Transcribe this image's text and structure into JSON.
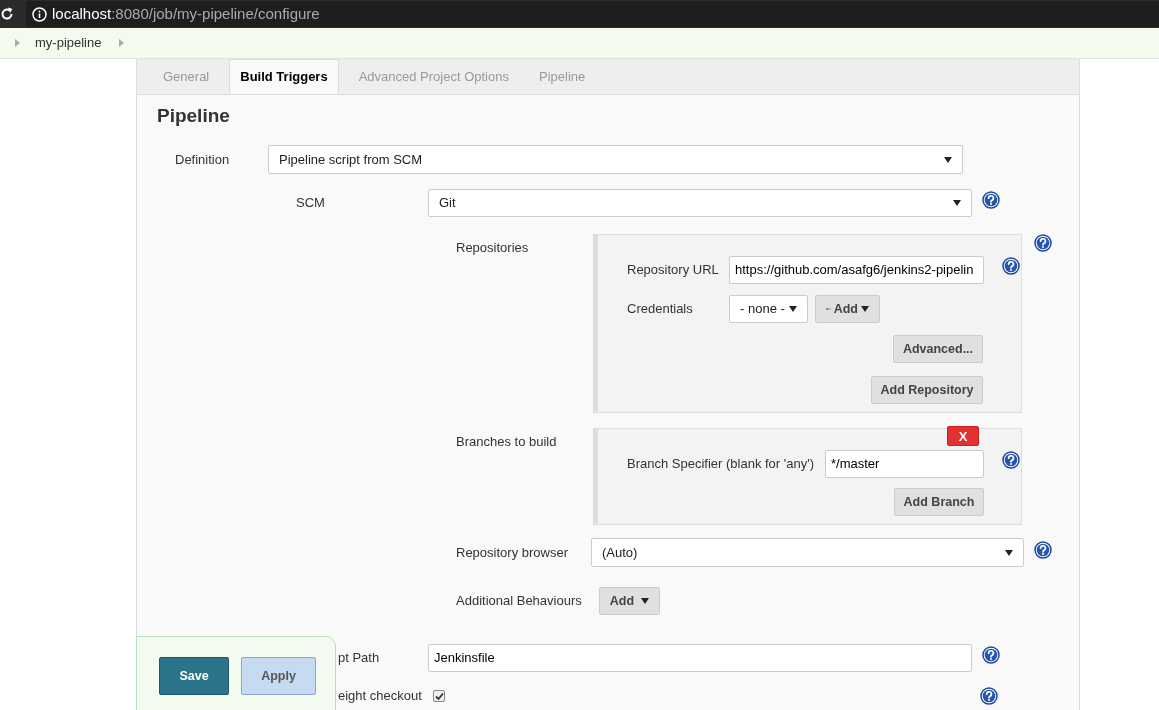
{
  "browser": {
    "url_host": "localhost",
    "url_path": ":8080/job/my-pipeline/configure"
  },
  "breadcrumbs": [
    "my-pipeline"
  ],
  "tabs": [
    {
      "label": "General",
      "selected": false
    },
    {
      "label": "Build Triggers",
      "selected": true
    },
    {
      "label": "Advanced Project Options",
      "selected": false
    },
    {
      "label": "Pipeline",
      "selected": false
    }
  ],
  "section": {
    "title": "Pipeline"
  },
  "definition": {
    "label": "Definition",
    "value": "Pipeline script from SCM"
  },
  "scm": {
    "label": "SCM",
    "value": "Git"
  },
  "repositories": {
    "label": "Repositories",
    "url_label": "Repository URL",
    "url": "https://github.com/asafg6/jenkins2-pipelin",
    "credentials_label": "Credentials",
    "credentials": "- none -",
    "add_button": "Add",
    "advanced_button": "Advanced...",
    "add_repository_button": "Add Repository"
  },
  "branches": {
    "label": "Branches to build",
    "delete_button": "X",
    "specifier_label": "Branch Specifier (blank for 'any')",
    "specifier": "*/master",
    "add_branch_button": "Add Branch"
  },
  "repository_browser": {
    "label": "Repository browser",
    "value": "(Auto)"
  },
  "additional_behaviours": {
    "label": "Additional Behaviours",
    "add_button": "Add"
  },
  "script_path": {
    "label": "pt Path",
    "value": "Jenkinsfile"
  },
  "lightweight_checkout": {
    "label": "eight checkout",
    "checked": true
  },
  "footer_buttons": [
    "Save",
    "Apply"
  ]
}
